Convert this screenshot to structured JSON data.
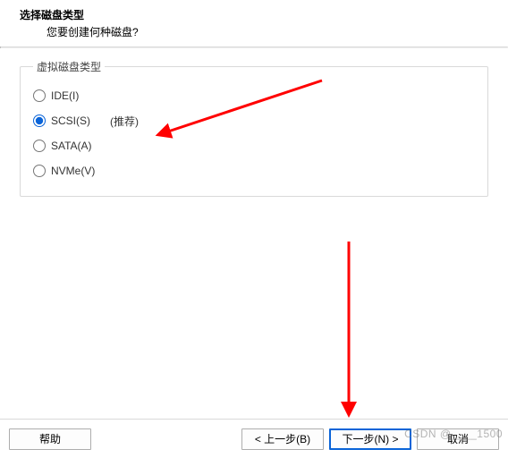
{
  "header": {
    "title": "选择磁盘类型",
    "subtitle": "您要创建何种磁盘?"
  },
  "group": {
    "legend": "虚拟磁盘类型",
    "recommended_suffix": "(推荐)",
    "options": {
      "ide": {
        "label": "IDE(I)",
        "selected": false
      },
      "scsi": {
        "label": "SCSI(S)",
        "selected": true
      },
      "sata": {
        "label": "SATA(A)",
        "selected": false
      },
      "nvme": {
        "label": "NVMe(V)",
        "selected": false
      }
    }
  },
  "footer": {
    "help": "帮助",
    "back": "< 上一步(B)",
    "next": "下一步(N) >",
    "cancel": "取消"
  },
  "watermark": "CSDN @____1500",
  "colors": {
    "accent": "#0a64d8",
    "arrow": "#ff0000"
  }
}
